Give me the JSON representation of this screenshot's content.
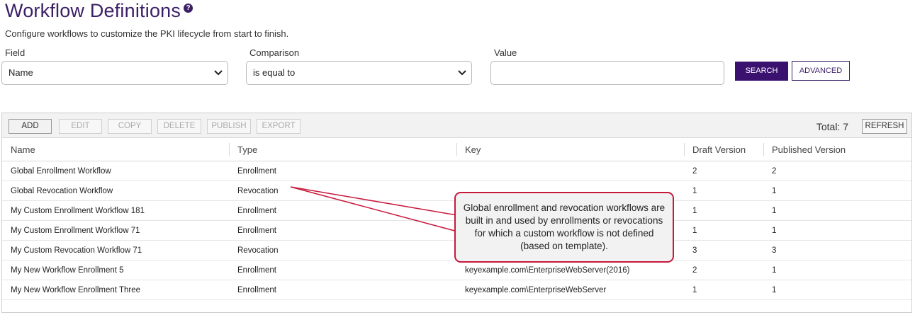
{
  "page": {
    "title": "Workflow Definitions",
    "help_icon": "?",
    "subtitle": "Configure workflows to customize the PKI lifecycle from start to finish."
  },
  "filters": {
    "field_label": "Field",
    "field_value": "Name",
    "comparison_label": "Comparison",
    "comparison_value": "is equal to",
    "value_label": "Value",
    "value_text": "",
    "search_label": "SEARCH",
    "advanced_label": "ADVANCED"
  },
  "toolbar": {
    "add": "ADD",
    "edit": "EDIT",
    "copy": "COPY",
    "delete": "DELETE",
    "publish": "PUBLISH",
    "export": "EXPORT",
    "total": "Total: 7",
    "refresh": "REFRESH"
  },
  "table": {
    "columns": [
      "Name",
      "Type",
      "Key",
      "Draft Version",
      "Published Version"
    ],
    "rows": [
      {
        "name": "Global Enrollment Workflow",
        "type": "Enrollment",
        "key": "",
        "draft": "2",
        "published": "2"
      },
      {
        "name": "Global Revocation Workflow",
        "type": "Revocation",
        "key": "",
        "draft": "1",
        "published": "1"
      },
      {
        "name": "My Custom Enrollment Workflow 181",
        "type": "Enrollment",
        "key": "",
        "draft": "1",
        "published": "1"
      },
      {
        "name": "My Custom Enrollment Workflow 71",
        "type": "Enrollment",
        "key": "",
        "draft": "1",
        "published": "1"
      },
      {
        "name": "My Custom Revocation Workflow 71",
        "type": "Revocation",
        "key": "",
        "draft": "3",
        "published": "3"
      },
      {
        "name": "My New Workflow Enrollment 5",
        "type": "Enrollment",
        "key": "keyexample.com\\EnterpriseWebServer(2016)",
        "draft": "2",
        "published": "1"
      },
      {
        "name": "My New Workflow Enrollment Three",
        "type": "Enrollment",
        "key": "keyexample.com\\EnterpriseWebServer",
        "draft": "1",
        "published": "1"
      }
    ]
  },
  "callout": {
    "text": "Global enrollment and revocation workflows are built in and used by enrollments or revocations for which a custom workflow is not defined (based on template).",
    "border_color": "#c8193c"
  },
  "colors": {
    "brand": "#3b1f66",
    "primary_button": "#3b1170"
  }
}
